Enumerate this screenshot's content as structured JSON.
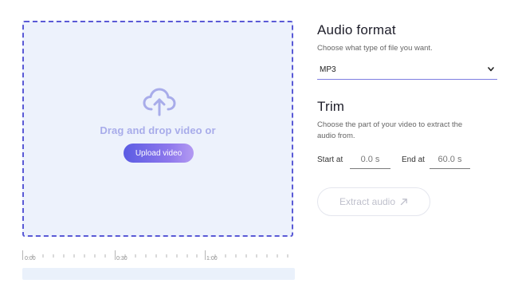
{
  "dropzone": {
    "prompt": "Drag and drop video or",
    "upload_button": "Upload video",
    "icon": "cloud-upload-icon"
  },
  "timeline": {
    "labels": [
      "0:00",
      "0:30",
      "1:00"
    ]
  },
  "audio_format": {
    "title": "Audio format",
    "description": "Choose what type of file you want.",
    "selected": "MP3"
  },
  "trim": {
    "title": "Trim",
    "description_line1": "Choose the part of your video to extract the",
    "description_line2": "audio from.",
    "start_label": "Start at",
    "start_value": "0.0 s",
    "end_label": "End at",
    "end_value": "60.0 s"
  },
  "extract_button": {
    "label": "Extract audio",
    "icon": "arrow-up-right-icon"
  },
  "colors": {
    "accent": "#5a5ad6",
    "dropzone_bg": "#edf2fc"
  }
}
